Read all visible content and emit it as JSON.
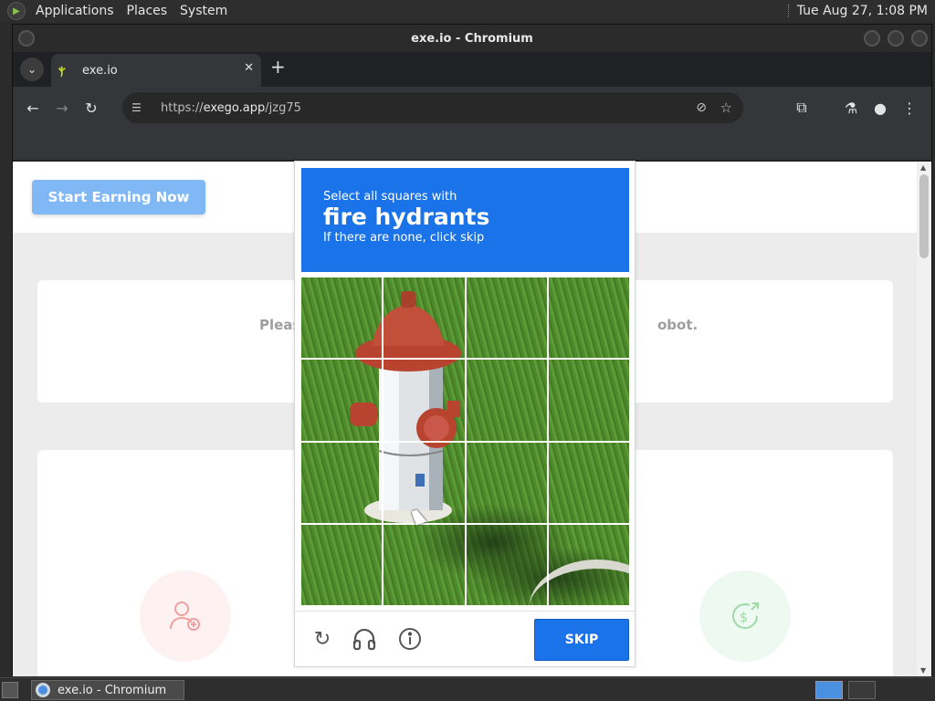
{
  "panel": {
    "menus": [
      "Applications",
      "Places",
      "System"
    ],
    "clock": "Tue Aug 27,  1:08 PM"
  },
  "window": {
    "title": "exe.io - Chromium"
  },
  "browser": {
    "tab_title": "exe.io",
    "url_scheme": "https://",
    "url_host": "exego.app",
    "url_path": "/jzg75"
  },
  "page": {
    "start_button": "Start Earning Now",
    "card_text_left": "Pleas",
    "card_text_right": "obot."
  },
  "captcha": {
    "line1": "Select all squares with",
    "target": "fire hydrants",
    "line3": "If there are none, click skip",
    "skip_label": "SKIP",
    "footer_icons": [
      "reload-icon",
      "audio-headphones-icon",
      "info-icon"
    ],
    "accent_color": "#1a73e8"
  },
  "taskbar": {
    "item_label": "exe.io - Chromium"
  }
}
